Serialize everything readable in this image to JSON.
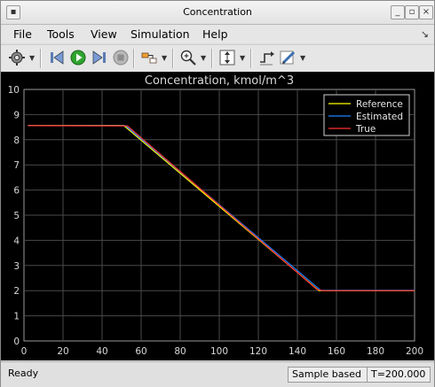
{
  "window": {
    "title": "Concentration"
  },
  "menu": {
    "file": "File",
    "tools": "Tools",
    "view": "View",
    "simulation": "Simulation",
    "help": "Help"
  },
  "status": {
    "state": "Ready",
    "mode": "Sample based",
    "time": "T=200.000"
  },
  "colors": {
    "reference": "#ffff00",
    "estimated": "#1f7fff",
    "true": "#ff3030",
    "axes_bg": "#000000",
    "grid": "#4a4a4a"
  },
  "chart_data": {
    "type": "line",
    "title": "Concentration, kmol/m^3",
    "xlabel": "",
    "ylabel": "",
    "xlim": [
      0,
      200
    ],
    "ylim": [
      0,
      10
    ],
    "xticks": [
      0,
      20,
      40,
      60,
      80,
      100,
      120,
      140,
      160,
      180,
      200
    ],
    "yticks": [
      0,
      1,
      2,
      3,
      4,
      5,
      6,
      7,
      8,
      9,
      10
    ],
    "grid": true,
    "legend_position": "top-right",
    "series": [
      {
        "name": "Reference",
        "color": "#ffff00",
        "points": [
          [
            2,
            8.57
          ],
          [
            51,
            8.57
          ],
          [
            151,
            2.0
          ],
          [
            200,
            2.0
          ]
        ]
      },
      {
        "name": "Estimated",
        "color": "#1f7fff",
        "points": [
          [
            2,
            8.56
          ],
          [
            52,
            8.56
          ],
          [
            152,
            2.01
          ],
          [
            200,
            2.01
          ]
        ]
      },
      {
        "name": "True",
        "color": "#ff3030",
        "points": [
          [
            2,
            8.56
          ],
          [
            53,
            8.55
          ],
          [
            150,
            2.05
          ],
          [
            153,
            2.0
          ],
          [
            200,
            2.0
          ]
        ]
      }
    ]
  }
}
